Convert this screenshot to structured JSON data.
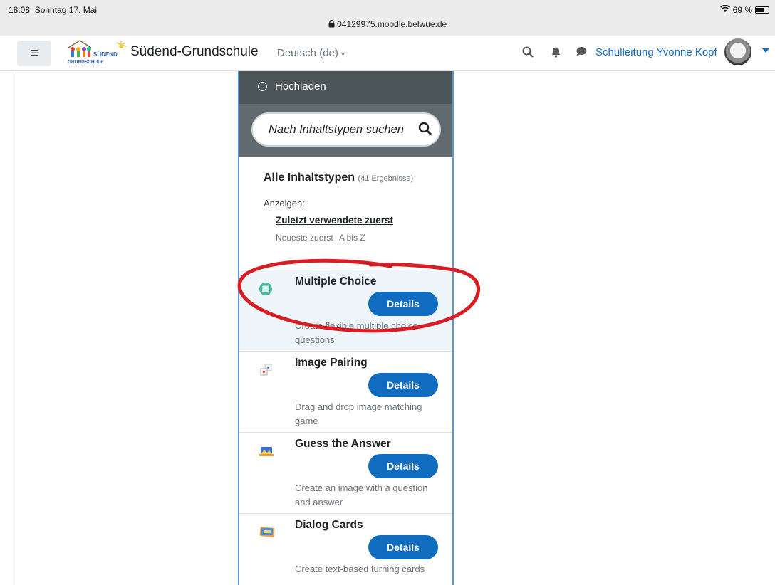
{
  "statusbar": {
    "time": "18:08",
    "date": "Sonntag 17. Mai",
    "url": "04129975.moodle.belwue.de",
    "battery_percent": "69 %",
    "battery_level": 0.69
  },
  "navbar": {
    "menu_icon": "hamburger-icon",
    "logo_text_top": "SÜDEND",
    "logo_text_bottom": "GRUNDSCHULE",
    "site_title": "Südend-Grundschule",
    "language": "Deutsch (de)",
    "user_name": "Schulleitung Yvonne Kopf",
    "icons": [
      "search-icon",
      "bell-icon",
      "chat-icon"
    ]
  },
  "panel": {
    "upload_label": "Hochladen",
    "search_placeholder": "Nach Inhaltstypen suchen",
    "results_title": "Alle Inhaltstypen",
    "results_count": "(41 Ergebnisse)",
    "show_label": "Anzeigen:",
    "sort_options": [
      "Zuletzt verwendete zuerst",
      "Neueste zuerst",
      "A bis Z"
    ],
    "items": [
      {
        "title": "Multiple Choice",
        "button": "Details",
        "desc": "Create flexible multiple choice questions",
        "icon": "multiple-choice-icon"
      },
      {
        "title": "Image Pairing",
        "button": "Details",
        "desc": "Drag and drop image matching game",
        "icon": "image-pairing-icon"
      },
      {
        "title": "Guess the Answer",
        "button": "Details",
        "desc": "Create an image with a question and answer",
        "icon": "guess-answer-icon"
      },
      {
        "title": "Dialog Cards",
        "button": "Details",
        "desc": "Create text-based turning cards",
        "icon": "dialog-cards-icon"
      }
    ]
  },
  "colors": {
    "accent": "#0f6cbf",
    "annotation": "#d81e24",
    "upload_bg": "#4c5558",
    "search_bg": "#616a6f"
  }
}
